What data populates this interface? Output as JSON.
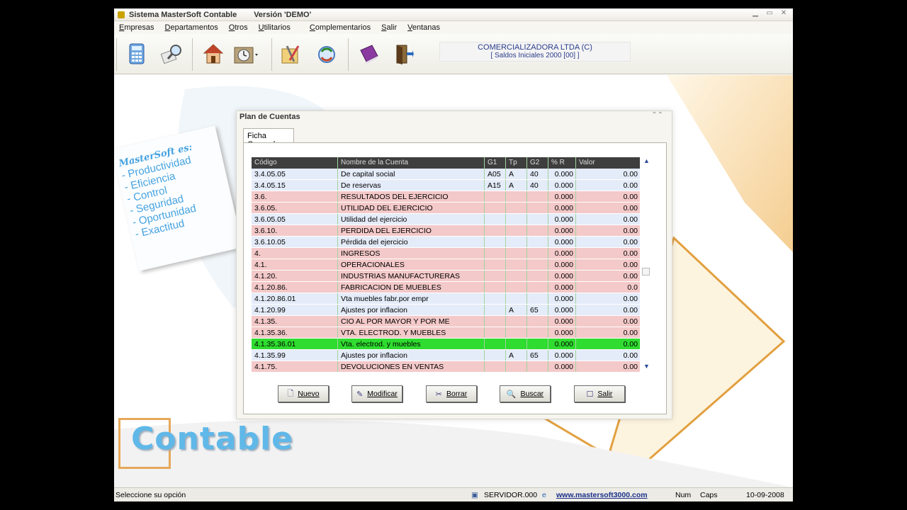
{
  "window": {
    "title": "Sistema  MasterSoft Contable",
    "version": "Versión 'DEMO'"
  },
  "menu": [
    "Empresas",
    "Departamentos",
    "Otros",
    "Utilitarios",
    "Complementarios",
    "Salir",
    "Ventanas"
  ],
  "toolbar": {
    "icons": [
      "calculator-icon",
      "search-tool-icon",
      "home-icon",
      "clock-icon",
      "tools-icon",
      "refresh-icon",
      "book-icon",
      "exit-door-icon"
    ],
    "company": "COMERCIALIZADORA LTDA (C)",
    "period": "[ Saldos Iniciales 2000 [00] ]"
  },
  "banner": {
    "heading": "MasterSoft es:",
    "items": [
      "- Productividad",
      "- Eficiencia",
      "- Control",
      "- Seguridad",
      "- Oportunidad",
      "- Exactitud"
    ]
  },
  "logo": {
    "text": "Contable"
  },
  "dialog": {
    "title": "Plan de Cuentas",
    "tab": "Ficha General",
    "columns": [
      "Código",
      "Nombre de la Cuenta",
      "G1",
      "Tp",
      "G2",
      "% R",
      "Valor"
    ],
    "rows": [
      {
        "cod": "3.4.05.05",
        "name": "De capital social",
        "g1": "A05",
        "tp": "A",
        "g2": "40",
        "pr": "0.000",
        "val": "0.00",
        "type": "w"
      },
      {
        "cod": "3.4.05.15",
        "name": "De reservas",
        "g1": "A15",
        "tp": "A",
        "g2": "40",
        "pr": "0.000",
        "val": "0.00",
        "type": "w"
      },
      {
        "cod": "3.6.",
        "name": "RESULTADOS DEL EJERCICIO",
        "g1": "",
        "tp": "",
        "g2": "",
        "pr": "0.000",
        "val": "0.00",
        "type": "p"
      },
      {
        "cod": "3.6.05.",
        "name": "UTILIDAD DEL EJERCICIO",
        "g1": "",
        "tp": "",
        "g2": "",
        "pr": "0.000",
        "val": "0.00",
        "type": "p"
      },
      {
        "cod": "3.6.05.05",
        "name": "Utilidad del ejercicio",
        "g1": "",
        "tp": "",
        "g2": "",
        "pr": "0.000",
        "val": "0.00",
        "type": "w"
      },
      {
        "cod": "3.6.10.",
        "name": "PERDIDA DEL EJERCICIO",
        "g1": "",
        "tp": "",
        "g2": "",
        "pr": "0.000",
        "val": "0.00",
        "type": "p"
      },
      {
        "cod": "3.6.10.05",
        "name": "Pérdida del ejercicio",
        "g1": "",
        "tp": "",
        "g2": "",
        "pr": "0.000",
        "val": "0.00",
        "type": "w"
      },
      {
        "cod": "4.",
        "name": "INGRESOS",
        "g1": "",
        "tp": "",
        "g2": "",
        "pr": "0.000",
        "val": "0.00",
        "type": "p"
      },
      {
        "cod": "4.1.",
        "name": "OPERACIONALES",
        "g1": "",
        "tp": "",
        "g2": "",
        "pr": "0.000",
        "val": "0.00",
        "type": "p"
      },
      {
        "cod": "4.1.20.",
        "name": "INDUSTRIAS MANUFACTURERAS",
        "g1": "",
        "tp": "",
        "g2": "",
        "pr": "0.000",
        "val": "0.00",
        "type": "p"
      },
      {
        "cod": "4.1.20.86.",
        "name": "FABRICACION DE MUEBLES",
        "g1": "",
        "tp": "",
        "g2": "",
        "pr": "0.000",
        "val": "0.0",
        "type": "p"
      },
      {
        "cod": "4.1.20.86.01",
        "name": "Vta muebles fabr.por empr",
        "g1": "",
        "tp": "",
        "g2": "",
        "pr": "0.000",
        "val": "0.00",
        "type": "w"
      },
      {
        "cod": "4.1.20.99",
        "name": "Ajustes por inflacion",
        "g1": "",
        "tp": "A",
        "g2": "65",
        "pr": "0.000",
        "val": "0.00",
        "type": "w"
      },
      {
        "cod": "4.1.35.",
        "name": "CIO AL POR MAYOR Y POR ME",
        "g1": "",
        "tp": "",
        "g2": "",
        "pr": "0.000",
        "val": "0.00",
        "type": "p"
      },
      {
        "cod": "4.1.35.36.",
        "name": "VTA. ELECTROD. Y MUEBLES",
        "g1": "",
        "tp": "",
        "g2": "",
        "pr": "0.000",
        "val": "0.00",
        "type": "p"
      },
      {
        "cod": "4.1.35.36.01",
        "name": "Vta. electrod. y muebles",
        "g1": "",
        "tp": "",
        "g2": "",
        "pr": "0.000",
        "val": "0.00",
        "type": "sel"
      },
      {
        "cod": "4.1.35.99",
        "name": "Ajustes por inflacion",
        "g1": "",
        "tp": "A",
        "g2": "65",
        "pr": "0.000",
        "val": "0.00",
        "type": "w"
      },
      {
        "cod": "4.1.75.",
        "name": "DEVOLUCIONES EN VENTAS",
        "g1": "",
        "tp": "",
        "g2": "",
        "pr": "0.000",
        "val": "0.00",
        "type": "p"
      }
    ],
    "buttons": {
      "nuevo": "Nuevo",
      "modificar": "Modificar",
      "borrar": "Borrar",
      "buscar": "Buscar",
      "salir": "Salir"
    }
  },
  "statusbar": {
    "message": "Seleccione su opción",
    "server": "SERVIDOR.000",
    "link": "www.mastersoft3000.com",
    "num": "Num",
    "caps": "Caps",
    "date": "10-09-2008"
  }
}
